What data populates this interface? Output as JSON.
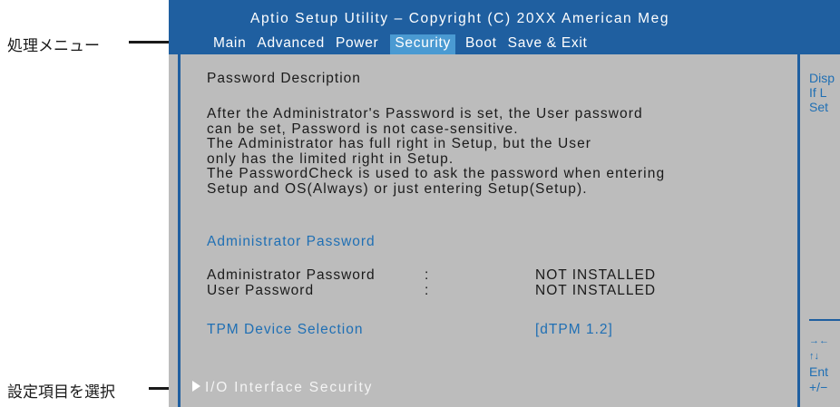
{
  "callouts": {
    "menu_label": "処理メニュー",
    "select_label": "設定項目を選択"
  },
  "header": {
    "title": "Aptio Setup Utility – Copyright (C) 20XX American Meg"
  },
  "menu": {
    "items": [
      "Main",
      "Advanced",
      "Power",
      "Security",
      "Boot",
      "Save & Exit"
    ],
    "active": "Security"
  },
  "content": {
    "section_title": "Password Description",
    "description_lines": [
      "After the Administrator's Password is set, the User password",
      "can be set, Password is not case-sensitive.",
      "The Administrator has full right in Setup, but the User",
      "only has the limited right in Setup.",
      "The PasswordCheck is used to ask the password when entering",
      "Setup and OS(Always) or just entering Setup(Setup)."
    ],
    "admin_password_link": "Administrator Password",
    "rows": [
      {
        "label": "Administrator Password",
        "sep": ":",
        "value": "NOT INSTALLED"
      },
      {
        "label": "User Password",
        "sep": ":",
        "value": "NOT INSTALLED"
      }
    ],
    "tpm_label": "TPM Device Selection",
    "tpm_value": "[dTPM 1.2]",
    "io_security": "I/O Interface Security"
  },
  "help": {
    "top_lines": [
      "Disp",
      "If L",
      "Set"
    ],
    "bottom_lines": [
      "→←",
      "↑↓",
      "Ent",
      "+/−"
    ]
  },
  "colors": {
    "header_bg": "#1f5fa0",
    "active_tab_bg": "#4a9ad2",
    "panel_bg": "#bcbcbc",
    "link_blue": "#1f6fb4"
  }
}
